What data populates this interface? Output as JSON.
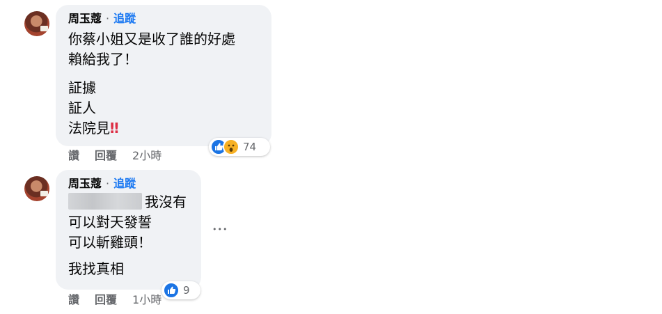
{
  "comments": [
    {
      "author": "周玉蔻",
      "separator": "·",
      "follow_label": "追蹤",
      "paragraphs": [
        [
          "你蔡小姐又是收了誰的好處",
          "賴給我了！"
        ],
        [
          "証據",
          "証人",
          "法院見"
        ]
      ],
      "emoji": "‼",
      "reactions": {
        "icons": [
          "like-icon",
          "wow-icon"
        ],
        "count": "74"
      },
      "actions": {
        "like": "讚",
        "reply": "回覆",
        "time": "2小時"
      }
    },
    {
      "author": "周玉蔻",
      "separator": "·",
      "follow_label": "追蹤",
      "first_line_visible": "我沒有",
      "lines": [
        "可以對天發誓",
        "可以斬雞頭！"
      ],
      "paragraph2": "我找真相",
      "reactions": {
        "icons": [
          "like-icon"
        ],
        "count": "9"
      },
      "actions": {
        "like": "讚",
        "reply": "回覆",
        "time": "1小時"
      },
      "more_label": "•••"
    }
  ],
  "colors": {
    "link_blue": "#1877f2",
    "bubble_bg": "#f0f2f5",
    "muted": "#65676b"
  }
}
